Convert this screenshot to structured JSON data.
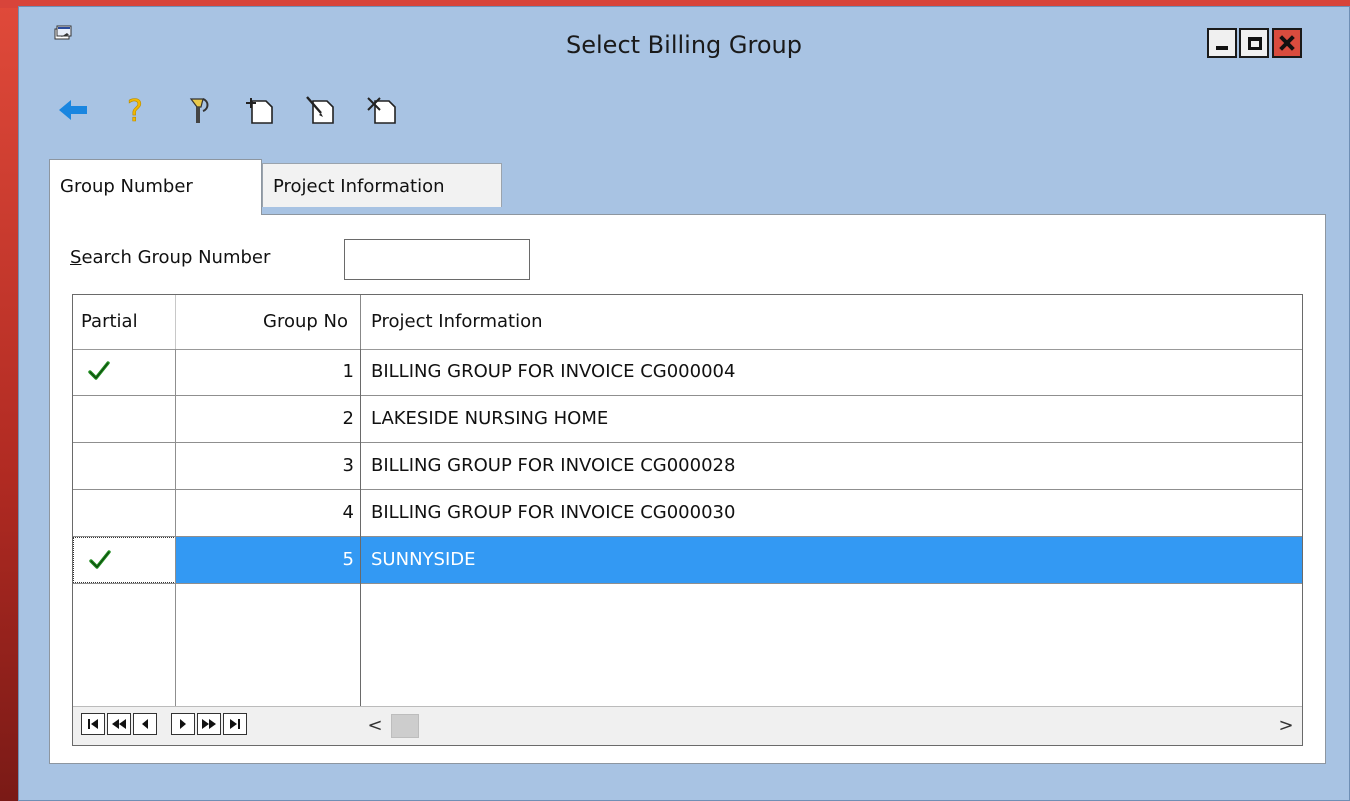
{
  "window": {
    "title": "Select Billing Group",
    "accent": "#a8c3e3",
    "close_color": "#d94c3e"
  },
  "toolbar": {
    "items": [
      {
        "icon": "back-arrow-icon"
      },
      {
        "icon": "help-question-icon"
      },
      {
        "icon": "tools-icon"
      },
      {
        "icon": "add-record-icon"
      },
      {
        "icon": "edit-record-icon"
      },
      {
        "icon": "delete-record-icon"
      }
    ]
  },
  "tabs": [
    {
      "label": "Group Number",
      "active": true
    },
    {
      "label": "Project Information",
      "active": false
    }
  ],
  "search": {
    "label_accel": "S",
    "label_rest": "earch Group Number",
    "value": ""
  },
  "grid": {
    "headers": {
      "partial": "Partial",
      "group_no": "Group No",
      "project": "Project Information"
    },
    "rows": [
      {
        "partial": true,
        "group_no": "1",
        "project": "BILLING GROUP FOR INVOICE CG000004",
        "selected": false
      },
      {
        "partial": false,
        "group_no": "2",
        "project": "LAKESIDE NURSING HOME",
        "selected": false
      },
      {
        "partial": false,
        "group_no": "3",
        "project": "BILLING GROUP FOR INVOICE CG000028",
        "selected": false
      },
      {
        "partial": false,
        "group_no": "4",
        "project": "BILLING GROUP FOR INVOICE CG000030",
        "selected": false
      },
      {
        "partial": true,
        "group_no": "5",
        "project": "SUNNYSIDE",
        "selected": true
      }
    ],
    "selected_color": "#3399f3",
    "check_color": "#1e8a1e"
  },
  "scrollbar": {
    "left_arrow": "<",
    "right_arrow": ">"
  }
}
